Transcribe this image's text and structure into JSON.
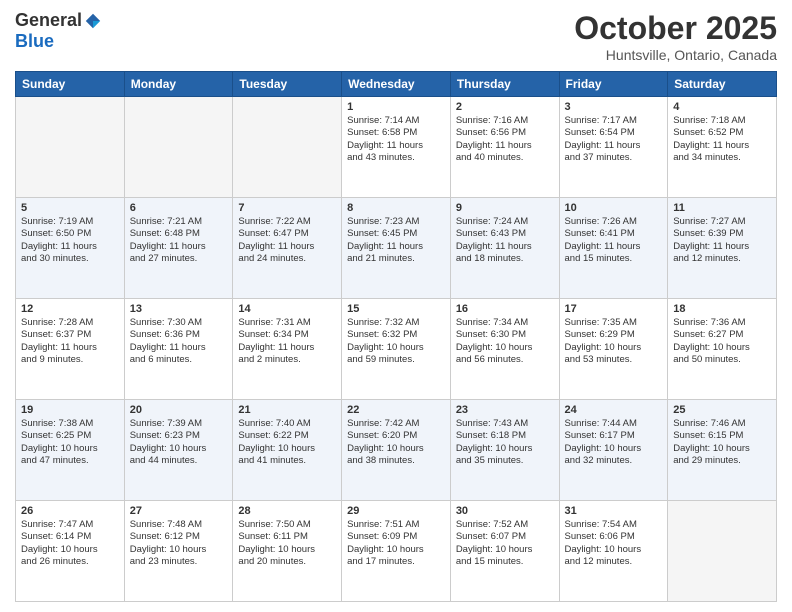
{
  "header": {
    "logo_general": "General",
    "logo_blue": "Blue",
    "month_title": "October 2025",
    "location": "Huntsville, Ontario, Canada"
  },
  "weekdays": [
    "Sunday",
    "Monday",
    "Tuesday",
    "Wednesday",
    "Thursday",
    "Friday",
    "Saturday"
  ],
  "weeks": [
    [
      {
        "day": "",
        "info": ""
      },
      {
        "day": "",
        "info": ""
      },
      {
        "day": "",
        "info": ""
      },
      {
        "day": "1",
        "info": "Sunrise: 7:14 AM\nSunset: 6:58 PM\nDaylight: 11 hours\nand 43 minutes."
      },
      {
        "day": "2",
        "info": "Sunrise: 7:16 AM\nSunset: 6:56 PM\nDaylight: 11 hours\nand 40 minutes."
      },
      {
        "day": "3",
        "info": "Sunrise: 7:17 AM\nSunset: 6:54 PM\nDaylight: 11 hours\nand 37 minutes."
      },
      {
        "day": "4",
        "info": "Sunrise: 7:18 AM\nSunset: 6:52 PM\nDaylight: 11 hours\nand 34 minutes."
      }
    ],
    [
      {
        "day": "5",
        "info": "Sunrise: 7:19 AM\nSunset: 6:50 PM\nDaylight: 11 hours\nand 30 minutes."
      },
      {
        "day": "6",
        "info": "Sunrise: 7:21 AM\nSunset: 6:48 PM\nDaylight: 11 hours\nand 27 minutes."
      },
      {
        "day": "7",
        "info": "Sunrise: 7:22 AM\nSunset: 6:47 PM\nDaylight: 11 hours\nand 24 minutes."
      },
      {
        "day": "8",
        "info": "Sunrise: 7:23 AM\nSunset: 6:45 PM\nDaylight: 11 hours\nand 21 minutes."
      },
      {
        "day": "9",
        "info": "Sunrise: 7:24 AM\nSunset: 6:43 PM\nDaylight: 11 hours\nand 18 minutes."
      },
      {
        "day": "10",
        "info": "Sunrise: 7:26 AM\nSunset: 6:41 PM\nDaylight: 11 hours\nand 15 minutes."
      },
      {
        "day": "11",
        "info": "Sunrise: 7:27 AM\nSunset: 6:39 PM\nDaylight: 11 hours\nand 12 minutes."
      }
    ],
    [
      {
        "day": "12",
        "info": "Sunrise: 7:28 AM\nSunset: 6:37 PM\nDaylight: 11 hours\nand 9 minutes."
      },
      {
        "day": "13",
        "info": "Sunrise: 7:30 AM\nSunset: 6:36 PM\nDaylight: 11 hours\nand 6 minutes."
      },
      {
        "day": "14",
        "info": "Sunrise: 7:31 AM\nSunset: 6:34 PM\nDaylight: 11 hours\nand 2 minutes."
      },
      {
        "day": "15",
        "info": "Sunrise: 7:32 AM\nSunset: 6:32 PM\nDaylight: 10 hours\nand 59 minutes."
      },
      {
        "day": "16",
        "info": "Sunrise: 7:34 AM\nSunset: 6:30 PM\nDaylight: 10 hours\nand 56 minutes."
      },
      {
        "day": "17",
        "info": "Sunrise: 7:35 AM\nSunset: 6:29 PM\nDaylight: 10 hours\nand 53 minutes."
      },
      {
        "day": "18",
        "info": "Sunrise: 7:36 AM\nSunset: 6:27 PM\nDaylight: 10 hours\nand 50 minutes."
      }
    ],
    [
      {
        "day": "19",
        "info": "Sunrise: 7:38 AM\nSunset: 6:25 PM\nDaylight: 10 hours\nand 47 minutes."
      },
      {
        "day": "20",
        "info": "Sunrise: 7:39 AM\nSunset: 6:23 PM\nDaylight: 10 hours\nand 44 minutes."
      },
      {
        "day": "21",
        "info": "Sunrise: 7:40 AM\nSunset: 6:22 PM\nDaylight: 10 hours\nand 41 minutes."
      },
      {
        "day": "22",
        "info": "Sunrise: 7:42 AM\nSunset: 6:20 PM\nDaylight: 10 hours\nand 38 minutes."
      },
      {
        "day": "23",
        "info": "Sunrise: 7:43 AM\nSunset: 6:18 PM\nDaylight: 10 hours\nand 35 minutes."
      },
      {
        "day": "24",
        "info": "Sunrise: 7:44 AM\nSunset: 6:17 PM\nDaylight: 10 hours\nand 32 minutes."
      },
      {
        "day": "25",
        "info": "Sunrise: 7:46 AM\nSunset: 6:15 PM\nDaylight: 10 hours\nand 29 minutes."
      }
    ],
    [
      {
        "day": "26",
        "info": "Sunrise: 7:47 AM\nSunset: 6:14 PM\nDaylight: 10 hours\nand 26 minutes."
      },
      {
        "day": "27",
        "info": "Sunrise: 7:48 AM\nSunset: 6:12 PM\nDaylight: 10 hours\nand 23 minutes."
      },
      {
        "day": "28",
        "info": "Sunrise: 7:50 AM\nSunset: 6:11 PM\nDaylight: 10 hours\nand 20 minutes."
      },
      {
        "day": "29",
        "info": "Sunrise: 7:51 AM\nSunset: 6:09 PM\nDaylight: 10 hours\nand 17 minutes."
      },
      {
        "day": "30",
        "info": "Sunrise: 7:52 AM\nSunset: 6:07 PM\nDaylight: 10 hours\nand 15 minutes."
      },
      {
        "day": "31",
        "info": "Sunrise: 7:54 AM\nSunset: 6:06 PM\nDaylight: 10 hours\nand 12 minutes."
      },
      {
        "day": "",
        "info": ""
      }
    ]
  ]
}
